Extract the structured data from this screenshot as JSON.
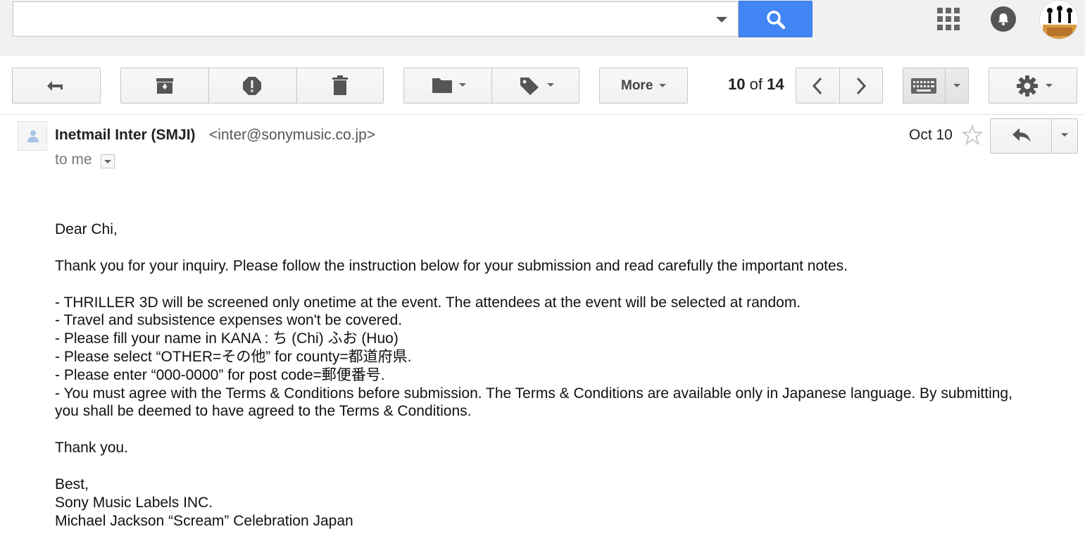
{
  "search": {
    "value": "",
    "placeholder": ""
  },
  "icons": {
    "search": "search-icon",
    "apps": "apps-grid-icon",
    "notifications": "bell-icon",
    "avatar": "account-avatar"
  },
  "toolbar": {
    "more_label": "More",
    "pager_current": "10",
    "pager_of": "of",
    "pager_total": "14"
  },
  "message": {
    "sender_name": "Inetmail Inter (SMJI)",
    "sender_email": "<inter@sonymusic.co.jp>",
    "to_label": "to me",
    "date": "Oct 10",
    "starred": false,
    "body": {
      "greeting": "Dear Chi,",
      "intro": "Thank you for your inquiry. Please follow the instruction below for your submission and read carefully the important notes.",
      "notes": [
        "-  THRILLER 3D will be screened only onetime at the event. The attendees at the event will be selected at random.",
        "-  Travel and subsistence expenses won't be covered.",
        "-  Please fill your name in KANA : ち (Chi) ふお (Huo)",
        "-  Please select “OTHER=その他” for county=都道府県.",
        "-  Please enter “000-0000” for post code=郵便番号.",
        "-  You must agree with the Terms & Conditions before submission. The Terms & Conditions are available only in Japanese language. By submitting, you shall be deemed to have agreed to the Terms & Conditions."
      ],
      "thanks": "Thank you.",
      "closing": "Best,",
      "signature_company": "Sony Music Labels INC.",
      "signature_event": "Michael Jackson “Scream” Celebration Japan"
    }
  },
  "colors": {
    "search_button": "#4285f4",
    "topbar_bg": "#f1f1f1",
    "icon_gray": "#666666"
  }
}
